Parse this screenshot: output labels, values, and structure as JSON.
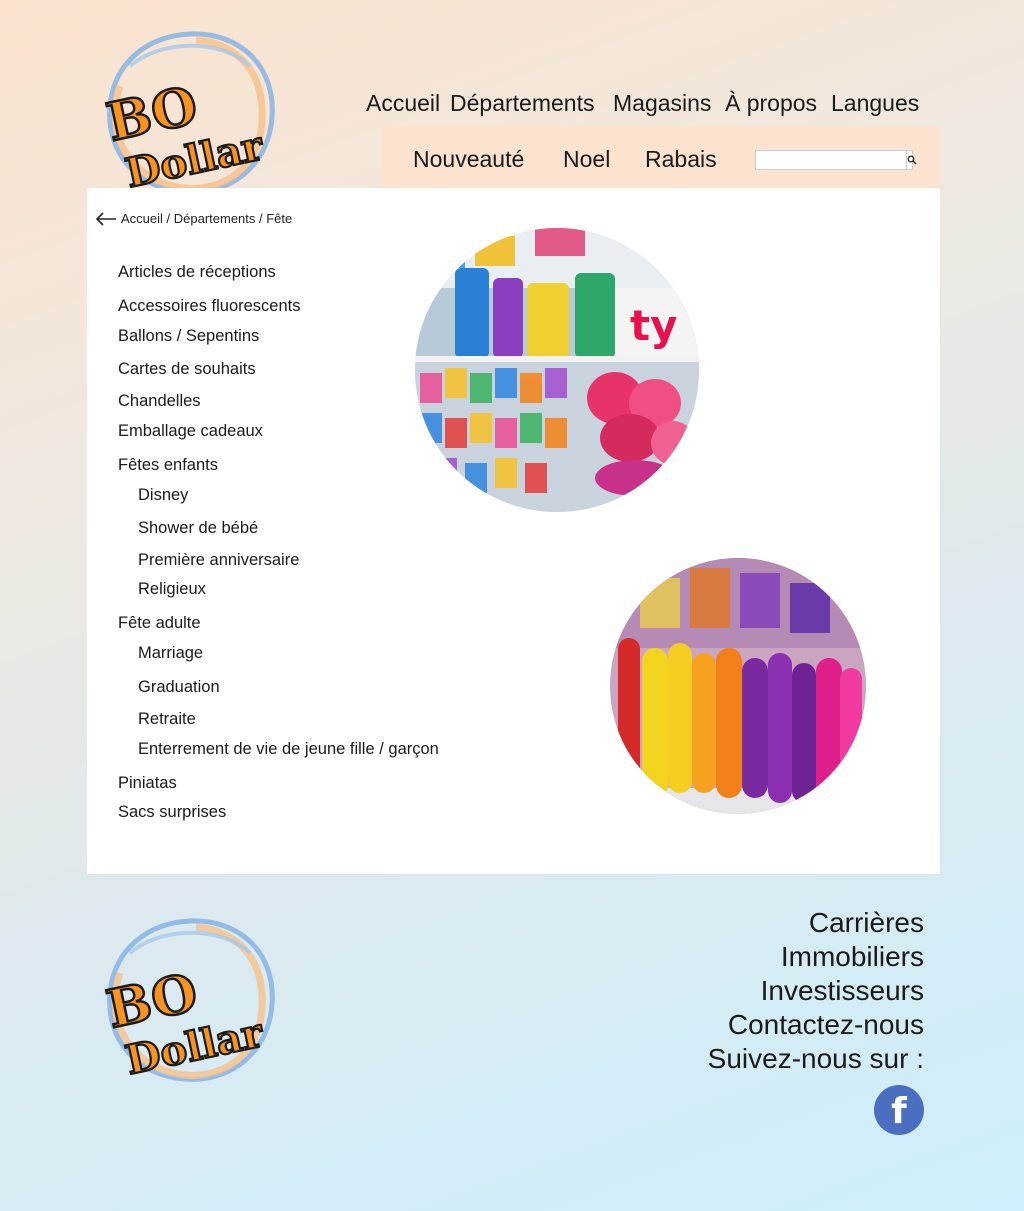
{
  "brand": {
    "line1": "BO",
    "line2": "Dollar"
  },
  "nav": {
    "main": [
      "Accueil",
      "Départements",
      "Magasins",
      "À propos",
      "Langues"
    ],
    "secondary": [
      "Nouveauté",
      "Noel",
      "Rabais"
    ]
  },
  "search": {
    "placeholder": ""
  },
  "breadcrumb": "Accueil / Départements / Fête",
  "categories": [
    "Articles de réceptions",
    "Accessoires fluorescents",
    "Ballons / Sepentins",
    "Cartes de souhaits",
    "Chandelles",
    "Emballage cadeaux",
    "Fêtes enfants",
    "Disney",
    "Shower de bébé",
    "Première anniversaire",
    "Religieux",
    "Fête adulte",
    "Marriage",
    "Graduation",
    "Retraite",
    "Enterrement de vie de jeune fille / garçon",
    "Piniatas",
    "Sacs surprises"
  ],
  "footer": {
    "links": [
      "Carrières",
      "Immobiliers",
      "Investisseurs",
      "Contactez-nous"
    ],
    "follow": "Suivez-nous sur :",
    "social_icon": "facebook-icon"
  },
  "colors": {
    "accent_orange": "#f7931e",
    "header_bar": "#fbe3cf",
    "facebook_blue": "#4a6ec0"
  }
}
